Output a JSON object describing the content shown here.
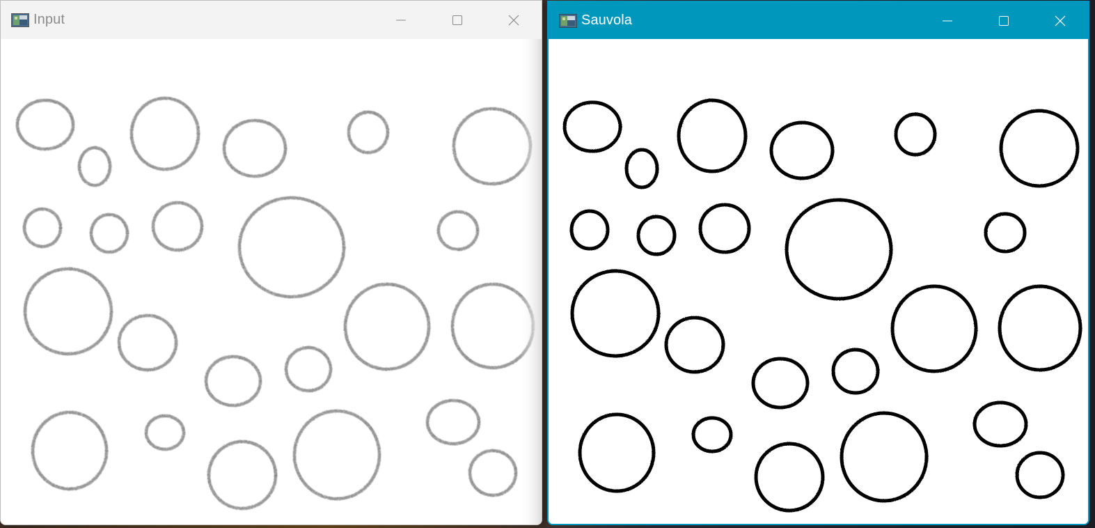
{
  "windows": {
    "input": {
      "title": "Input",
      "app_icon": "image-window-icon",
      "controls": [
        "minimize-icon",
        "maximize-icon",
        "close-icon"
      ],
      "title_color": "#8c8c8c",
      "titlebar_color": "#f3f3f3",
      "active": false
    },
    "sauvola": {
      "title": "Sauvola",
      "app_icon": "image-window-icon",
      "controls": [
        "minimize-icon",
        "maximize-icon",
        "close-icon"
      ],
      "title_color": "#ffffff",
      "titlebar_color": "#0097bd",
      "active": true
    }
  },
  "content": {
    "input_image": "circles-grayscale-noisy",
    "output_image": "circles-binarized-black"
  }
}
